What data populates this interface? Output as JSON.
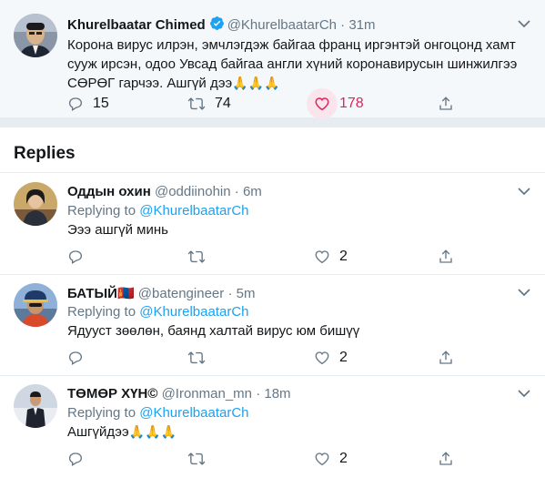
{
  "main_tweet": {
    "name": "Khurelbaatar Chimed",
    "handle": "@KhurelbaatarCh",
    "separator": "·",
    "time": "31m",
    "text": "Корона вирус илрэн, эмчлэгдэж байгаа франц иргэнтэй онгоцонд хамт суусан ирсэн, одоо Увсад байгаа англи хүний коронавирусын шинжилгээ СӨРӨГ гарчээ. Ашгүй дээ🙏🙏🙏",
    "text_line1": "Корона вирус илрэн, эмчлэгдэж байгаа франц иргэнтэй онгоцонд хамт",
    "text_line2": "сууж ирсэн, одоо Увсад байгаа англи хүний коронавирусын шинжилгээ",
    "text_line3": "СӨРӨГ гарчээ. Ашгүй дээ",
    "emoji": "🙏🙏🙏",
    "replies": "15",
    "retweets": "74",
    "likes": "178"
  },
  "replies_section": {
    "title": "Replies"
  },
  "replies": [
    {
      "name": "Оддын охин",
      "handle": "@oddiinohin",
      "separator": "·",
      "time": "6m",
      "replying_prefix": "Replying to",
      "replying_to": "@KhurelbaatarCh",
      "text": "Эээ ашгүй минь",
      "likes": "2"
    },
    {
      "name": "БАТЫЙ",
      "flag": "🇲🇳",
      "handle": "@batengineer",
      "separator": "·",
      "time": "5m",
      "replying_prefix": "Replying to",
      "replying_to": "@KhurelbaatarCh",
      "text": "Ядууст зөөлөн, баянд халтай вирус юм бишүү",
      "likes": "2"
    },
    {
      "name": "ТӨМӨР ХҮН©",
      "handle": "@Ironman_mn",
      "separator": "·",
      "time": "18m",
      "replying_prefix": "Replying to",
      "replying_to": "@KhurelbaatarCh",
      "text": "Ашгүйдээ",
      "emoji": "🙏🙏🙏",
      "likes": "2"
    }
  ],
  "colors": {
    "accent": "#1da1f2",
    "like": "#e0245e",
    "muted": "#657786",
    "highlight_bg": "#f5f8fa"
  }
}
